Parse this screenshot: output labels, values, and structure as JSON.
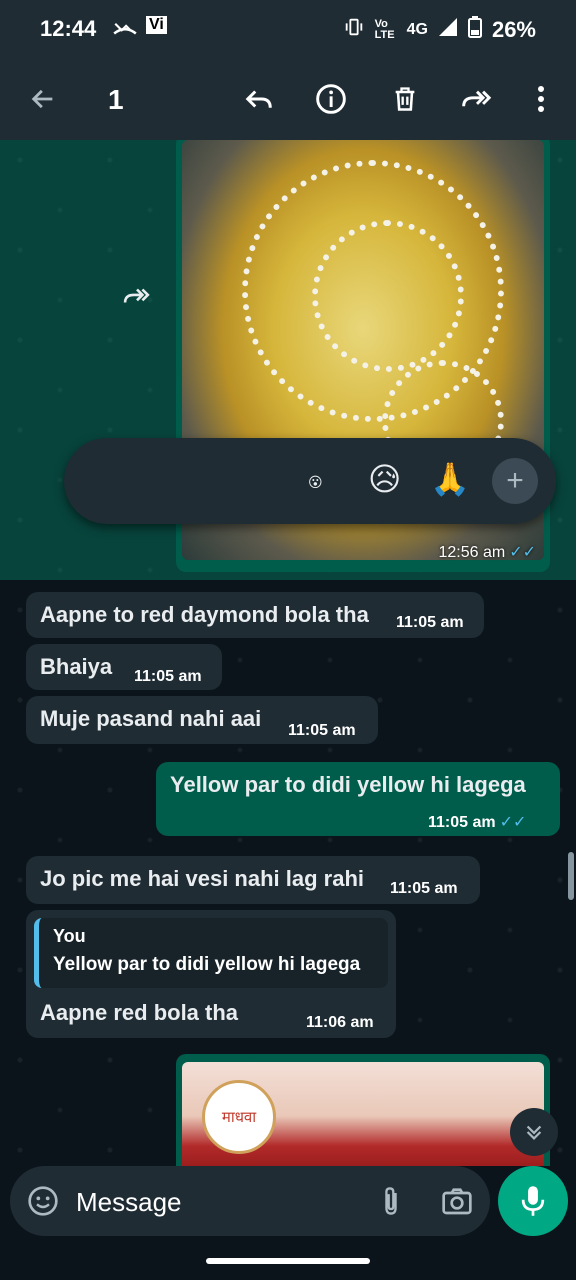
{
  "status_bar": {
    "time": "12:44",
    "carrier_badge": "Vi",
    "network": "4G",
    "volte": "Vo LTE",
    "battery": "26%"
  },
  "action_bar": {
    "selected_count": "1",
    "icons": [
      "back-arrow-icon",
      "reply-icon",
      "info-icon",
      "delete-icon",
      "forward-icon",
      "more-vert-icon"
    ]
  },
  "reactions": [
    "😮",
    "😥",
    "🙏"
  ],
  "messages": [
    {
      "type": "image",
      "direction": "out",
      "time": "12:56 am",
      "selected": true
    },
    {
      "type": "text",
      "direction": "in",
      "text": "Aapne to red daymond bola tha",
      "time": "11:05 am"
    },
    {
      "type": "text",
      "direction": "in",
      "text": "Bhaiya",
      "time": "11:05 am"
    },
    {
      "type": "text",
      "direction": "in",
      "text": "Muje pasand nahi aai",
      "time": "11:05 am"
    },
    {
      "type": "text",
      "direction": "out",
      "text": "Yellow par to didi yellow hi lagega",
      "time": "11:05 am"
    },
    {
      "type": "text",
      "direction": "in",
      "text": "Jo pic me hai vesi nahi lag rahi",
      "time": "11:05 am"
    },
    {
      "type": "reply",
      "direction": "in",
      "quote_author": "You",
      "quote_text": "Yellow par to didi yellow hi lagega",
      "text": "Aapne red bola tha",
      "time": "11:06 am"
    },
    {
      "type": "image",
      "direction": "out",
      "logo_text": "माधवा"
    }
  ],
  "input": {
    "placeholder": "Message"
  },
  "colors": {
    "chat_bg": "#0b141a",
    "bubble_in": "#1f2c34",
    "bubble_out": "#005c4b",
    "accent": "#00a884",
    "read_ticks": "#53bdeb"
  }
}
